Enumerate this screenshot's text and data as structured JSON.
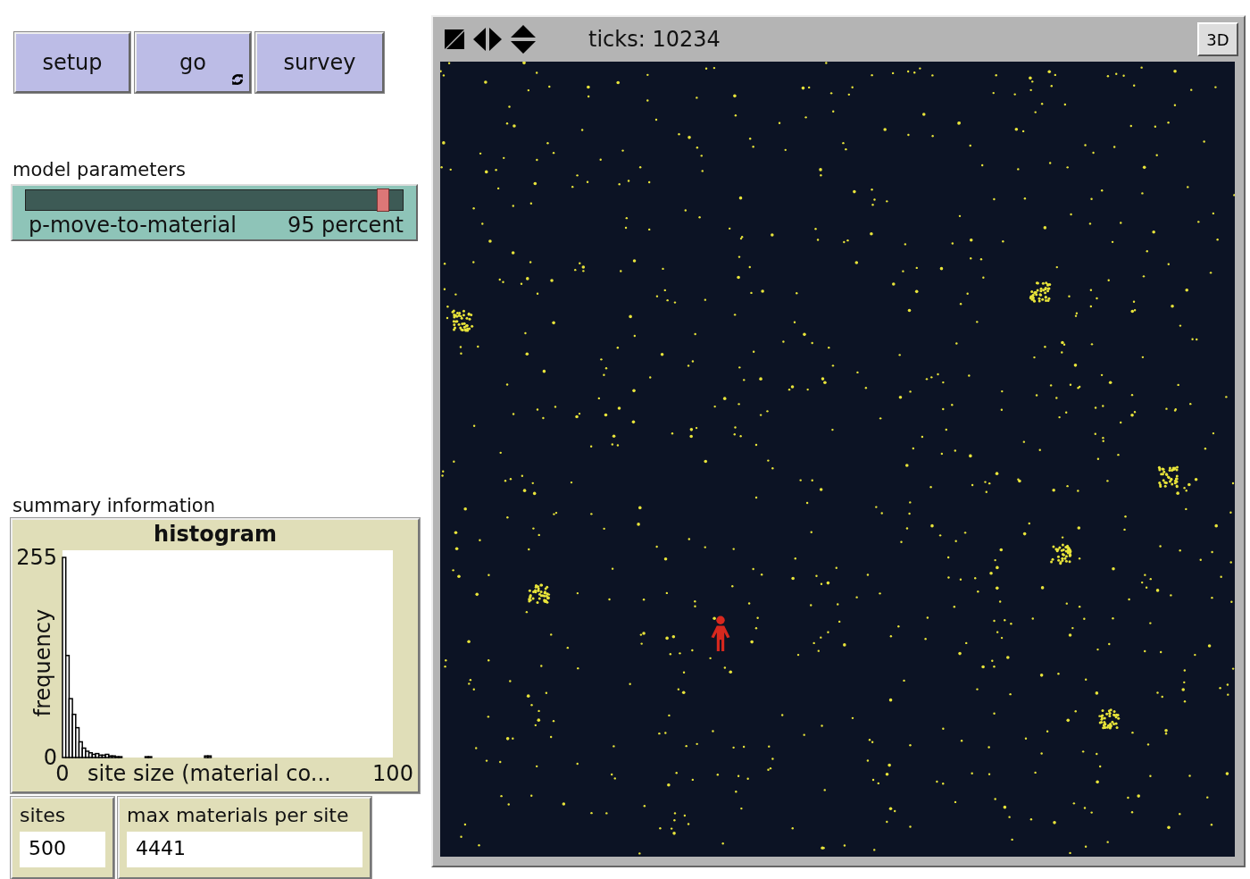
{
  "buttons": [
    {
      "label": "setup",
      "forever": false
    },
    {
      "label": "go",
      "forever": true
    },
    {
      "label": "survey",
      "forever": false
    }
  ],
  "parameters_title": "model parameters",
  "slider": {
    "name": "p-move-to-material",
    "reading": "95 percent",
    "level": 0.95
  },
  "summary_title": "summary information",
  "plot": {
    "title": "histogram",
    "chart_data": {
      "type": "bar",
      "xlabel": "site size (material co...",
      "ylabel": "frequency",
      "xlim": [
        0,
        100
      ],
      "ylim": [
        0,
        255
      ],
      "xticks": [
        0,
        100
      ],
      "yticks": [
        0,
        255
      ],
      "x": [
        0.5,
        1.5,
        2.5,
        3.5,
        4.5,
        5.5,
        6.5,
        7.5,
        8.5,
        9.5,
        10.5,
        11.5,
        12.5,
        13.5,
        14.5,
        15.5,
        16.5,
        17.5,
        18.5,
        19.5,
        20.5,
        21.5,
        22.5,
        23.5,
        24.5,
        25.5,
        26.5,
        27.5,
        28.5,
        29.5,
        30.5,
        31.5,
        32.5,
        33.5,
        34.5,
        35.5,
        36.5,
        37.5,
        38.5,
        39.5,
        40.5,
        41.5,
        42.5,
        43.5,
        44.5,
        45.5,
        46.5,
        47.5,
        48.5,
        49.5,
        50.5,
        51.5,
        52.5,
        53.5,
        54.5,
        55.5,
        56.5,
        57.5,
        58.5,
        59.5,
        60.5,
        61.5,
        62.5,
        63.5,
        64.5,
        65.5,
        66.5,
        67.5,
        68.5,
        69.5,
        70.5,
        71.5,
        72.5,
        73.5,
        74.5,
        75.5,
        76.5,
        77.5,
        78.5,
        79.5,
        80.5,
        81.5,
        82.5,
        83.5,
        84.5,
        85.5,
        86.5
      ],
      "values": [
        255,
        130,
        75,
        55,
        38,
        20,
        12,
        8,
        6,
        4,
        5,
        3,
        3,
        4,
        2,
        2,
        1,
        1,
        0,
        0,
        0,
        0,
        0,
        0,
        0,
        1,
        1,
        0,
        0,
        0,
        0,
        0,
        0,
        0,
        0,
        0,
        0,
        0,
        0,
        0,
        0,
        0,
        0,
        2,
        2,
        0,
        0,
        0,
        0,
        0,
        0,
        0,
        0,
        0,
        0,
        0,
        0,
        0,
        0,
        0,
        0,
        0,
        0,
        0,
        0,
        0,
        0,
        0,
        0,
        0,
        0,
        0,
        0,
        0,
        0,
        0,
        0,
        0,
        0,
        0,
        0,
        0,
        0,
        0,
        0,
        0,
        0
      ]
    }
  },
  "monitors": [
    {
      "label": "sites",
      "value": "500"
    },
    {
      "label": "max materials  per site",
      "value": "4441"
    }
  ],
  "view": {
    "ticks": "ticks: 10234",
    "three_d": "3D"
  }
}
